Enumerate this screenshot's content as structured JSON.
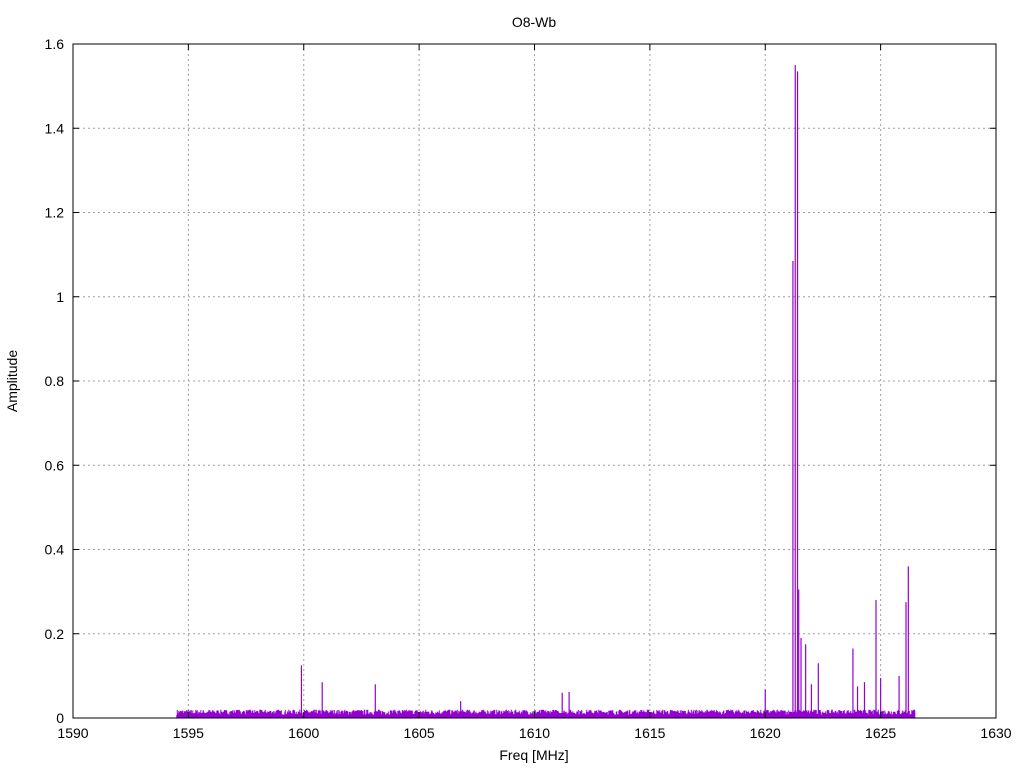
{
  "chart_data": {
    "type": "line",
    "title": "O8-Wb",
    "xlabel": "Freq [MHz]",
    "ylabel": "Amplitude",
    "xlim": [
      1590,
      1630
    ],
    "ylim": [
      0,
      1.6
    ],
    "x_ticks": [
      "1590",
      "1595",
      "1600",
      "1605",
      "1610",
      "1615",
      "1620",
      "1625",
      "1630"
    ],
    "y_ticks": [
      "0",
      "0.2",
      "0.4",
      "0.6",
      "0.8",
      "1",
      "1.2",
      "1.4",
      "1.6"
    ],
    "grid": true,
    "line_color": "#9400d3",
    "noise_floor": {
      "x_start": 1594.5,
      "x_end": 1626.5,
      "level": 0.02
    },
    "spikes": [
      {
        "x": 1599.9,
        "y": 0.125
      },
      {
        "x": 1600.8,
        "y": 0.085
      },
      {
        "x": 1603.1,
        "y": 0.08
      },
      {
        "x": 1606.8,
        "y": 0.04
      },
      {
        "x": 1611.2,
        "y": 0.06
      },
      {
        "x": 1611.5,
        "y": 0.062
      },
      {
        "x": 1620.0,
        "y": 0.068
      },
      {
        "x": 1621.2,
        "y": 1.085
      },
      {
        "x": 1621.3,
        "y": 1.55
      },
      {
        "x": 1621.4,
        "y": 1.535
      },
      {
        "x": 1621.45,
        "y": 0.305
      },
      {
        "x": 1621.55,
        "y": 0.19
      },
      {
        "x": 1621.75,
        "y": 0.175
      },
      {
        "x": 1622.0,
        "y": 0.08
      },
      {
        "x": 1622.3,
        "y": 0.13
      },
      {
        "x": 1623.8,
        "y": 0.165
      },
      {
        "x": 1624.0,
        "y": 0.075
      },
      {
        "x": 1624.3,
        "y": 0.085
      },
      {
        "x": 1624.8,
        "y": 0.28
      },
      {
        "x": 1625.0,
        "y": 0.095
      },
      {
        "x": 1625.8,
        "y": 0.1
      },
      {
        "x": 1626.1,
        "y": 0.275
      },
      {
        "x": 1626.2,
        "y": 0.36
      }
    ]
  }
}
